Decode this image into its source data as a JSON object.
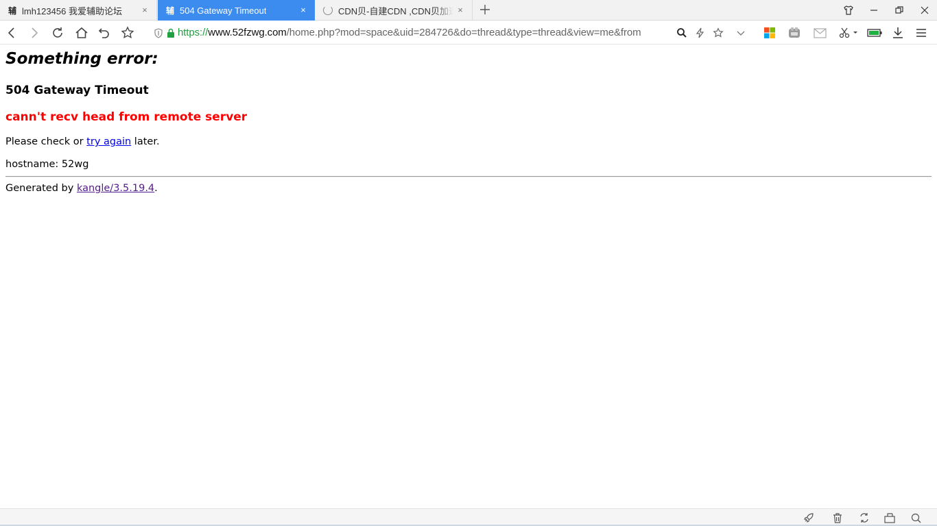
{
  "tabs": [
    {
      "favicon": "辅",
      "title": "lmh123456 我爱辅助论坛",
      "active": false
    },
    {
      "favicon": "辅",
      "title": "504 Gateway Timeout",
      "active": true
    },
    {
      "favicon": "loading-spinner",
      "title": "CDN贝-自建CDN ,CDN贝加速",
      "active": false
    }
  ],
  "tab_close_glyph": "×",
  "address_bar": {
    "scheme": "https://",
    "host": "www.52fzwg.com",
    "path": "/home.php?mod=space&uid=284726&do=thread&type=thread&view=me&from"
  },
  "toolbar_icons": [
    "back-icon",
    "forward-icon",
    "reload-icon",
    "home-icon",
    "undo-icon",
    "bookmark-star-icon",
    "shield-icon",
    "lock-icon",
    "search-icon",
    "lightning-icon",
    "favorite-star-icon",
    "dropdown-chevron-icon",
    "apps-grid-icon",
    "extension-icon",
    "mail-icon",
    "scissors-icon",
    "battery-icon",
    "download-icon",
    "menu-icon"
  ],
  "page": {
    "heading": "Something error:",
    "status": "504 Gateway Timeout",
    "error": "cann't recv head from remote server",
    "check_prefix": "Please check or ",
    "try_again_link": "try again",
    "check_suffix": " later.",
    "hostname": "hostname: 52wg",
    "generated_prefix": "Generated by ",
    "generator_link": "kangle/3.5.19.4",
    "generated_suffix": "."
  },
  "colors": {
    "active_tab": "#3c8cf0",
    "error_text": "#ff0000",
    "secure_scheme": "#20a040",
    "link": "#0000ee",
    "visited_link": "#551a8b"
  }
}
